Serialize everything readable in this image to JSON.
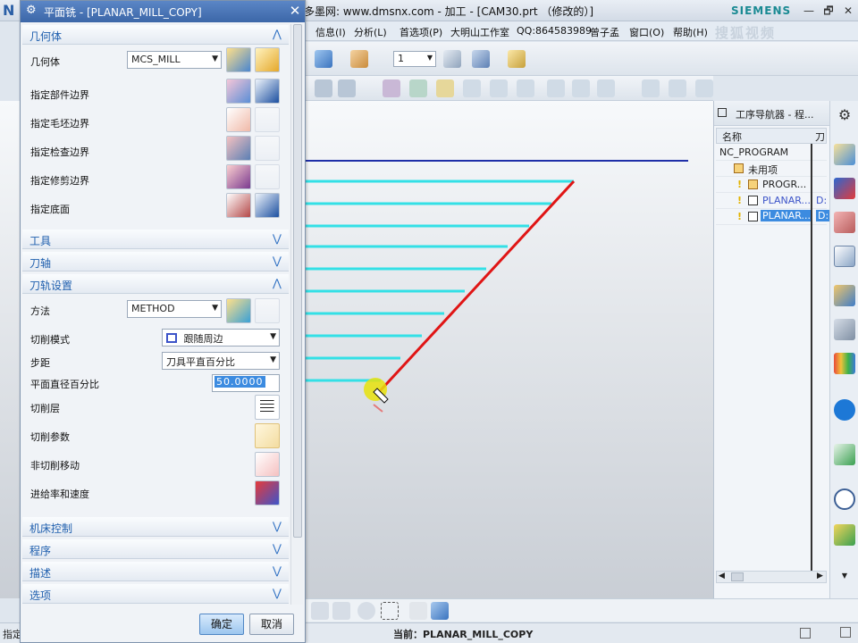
{
  "app": {
    "logo_letter": "N",
    "title": "多墨网: www.dmsnx.com - 加工 - [CAM30.prt （修改的）]",
    "brand": "SIEMENS",
    "minimize": "—",
    "restore": "🗗",
    "close": "✕"
  },
  "menubar": {
    "items": [
      "信息(I)",
      "分析(L)",
      "首选项(P)",
      "大明山工作室",
      "QQ:864583989",
      "曾子孟",
      "窗口(O)",
      "帮助(H)"
    ],
    "watermark": "搜狐视频"
  },
  "toolbar": {
    "layer_value": "1"
  },
  "dialog": {
    "title": "平面铣 - [PLANAR_MILL_COPY]",
    "sections": {
      "geometry": "几何体",
      "tool": "工具",
      "tool_axis": "刀轴",
      "path_settings": "刀轨设置",
      "machine_control": "机床控制",
      "program": "程序",
      "description": "描述",
      "options": "选项"
    },
    "geometry": {
      "label": "几何体",
      "value": "MCS_MILL",
      "rows": [
        "指定部件边界",
        "指定毛坯边界",
        "指定检查边界",
        "指定修剪边界",
        "指定底面"
      ]
    },
    "path": {
      "method_label": "方法",
      "method_value": "METHOD",
      "cut_pattern_label": "切削模式",
      "cut_pattern_value": "跟随周边",
      "stepover_label": "步距",
      "stepover_value": "刀具平直百分比",
      "flat_pct_label": "平面直径百分比",
      "flat_pct_value": "50.0000",
      "cut_levels_label": "切削层",
      "cut_params_label": "切削参数",
      "noncut_label": "非切削移动",
      "feeds_label": "进给率和速度"
    },
    "ok": "确定",
    "cancel": "取消"
  },
  "navigator": {
    "title": "工序导航器 - 程...",
    "col_name": "名称",
    "col_tool": "刀",
    "rows": [
      {
        "name": "NC_PROGRAM",
        "tool": ""
      },
      {
        "name": "未用项",
        "tool": ""
      },
      {
        "name": "PROGR...",
        "tool": ""
      },
      {
        "name": "PLANAR...",
        "tool": "D:"
      },
      {
        "name": "PLANAR...",
        "tool": "D:"
      }
    ]
  },
  "status": {
    "left": "指定",
    "current": "当前：PLANAR_MILL_COPY"
  },
  "colors": {
    "path_lines": "#33e0e6",
    "edge_line": "#1f2fa8",
    "tool_line": "#e01515",
    "accent_blue": "#1f5fae"
  }
}
